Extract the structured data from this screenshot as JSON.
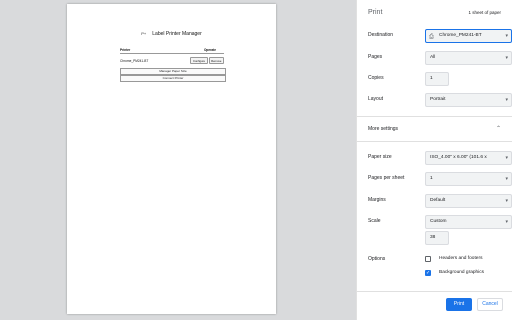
{
  "preview": {
    "page_title": "Label Printer Manager",
    "logo_text": "P+",
    "table": {
      "headers": [
        "Printer",
        "Operate"
      ],
      "rows": [
        {
          "printer": "Chrome_PM241-BT",
          "actions": [
            "Configure",
            "Remove"
          ]
        }
      ]
    },
    "manage_button": "Manager Paper Size",
    "connect_button": "Connect Printer"
  },
  "panel": {
    "title": "Print",
    "sheets": "1 sheet of paper",
    "destination": {
      "label": "Destination",
      "value": "Chrome_PM241-BT"
    },
    "pages": {
      "label": "Pages",
      "value": "All"
    },
    "copies": {
      "label": "Copies",
      "value": "1"
    },
    "layout": {
      "label": "Layout",
      "value": "Portrait"
    },
    "more_settings": "More settings",
    "paper_size": {
      "label": "Paper size",
      "value": "ISO_4.00\" x 6.00\" (101.6 x"
    },
    "pages_per_sheet": {
      "label": "Pages per sheet",
      "value": "1"
    },
    "margins": {
      "label": "Margins",
      "value": "Default"
    },
    "scale": {
      "label": "Scale",
      "value": "Custom",
      "custom_value": "38"
    },
    "options": {
      "label": "Options",
      "headers_footers": {
        "label": "Headers and footers",
        "checked": false
      },
      "background_graphics": {
        "label": "Background graphics",
        "checked": true
      }
    },
    "print_button": "Print",
    "cancel_button": "Cancel"
  },
  "colors": {
    "accent": "#1a73e8",
    "background": "#d9dadc"
  }
}
